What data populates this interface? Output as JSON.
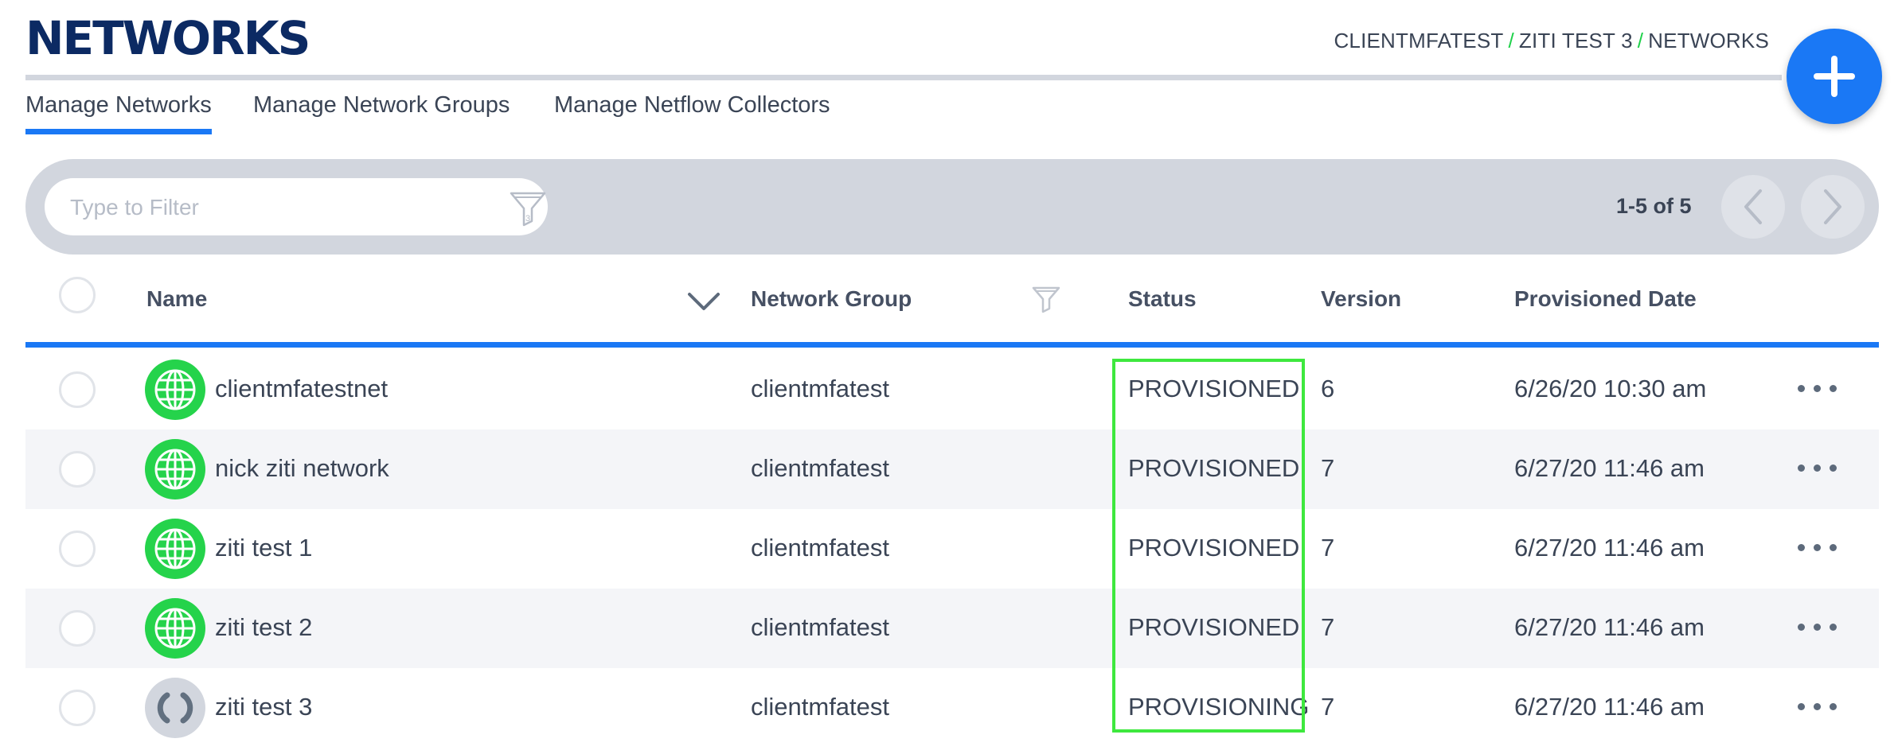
{
  "header": {
    "title": "NETWORKS",
    "breadcrumb": [
      "CLIENTMFATEST",
      "ZITI TEST 3",
      "NETWORKS"
    ],
    "breadcrumb_separator": "/"
  },
  "fab": {
    "icon": "plus-icon"
  },
  "tabs": [
    {
      "label": "Manage Networks",
      "active": true
    },
    {
      "label": "Manage Network Groups",
      "active": false
    },
    {
      "label": "Manage Netflow Collectors",
      "active": false
    }
  ],
  "filter": {
    "placeholder": "Type to Filter",
    "value": ""
  },
  "pagination": {
    "label": "1-5 of 5"
  },
  "columns": {
    "name": "Name",
    "network_group": "Network Group",
    "status": "Status",
    "version": "Version",
    "provisioned_date": "Provisioned Date"
  },
  "rows": [
    {
      "name": "clientmfatestnet",
      "network_group": "clientmfatest",
      "status": "PROVISIONED",
      "version": "6",
      "provisioned_date": "6/26/20 10:30 am",
      "icon": "globe-icon"
    },
    {
      "name": "nick ziti network",
      "network_group": "clientmfatest",
      "status": "PROVISIONED",
      "version": "7",
      "provisioned_date": "6/27/20 11:46 am",
      "icon": "globe-icon"
    },
    {
      "name": "ziti test 1",
      "network_group": "clientmfatest",
      "status": "PROVISIONED",
      "version": "7",
      "provisioned_date": "6/27/20 11:46 am",
      "icon": "globe-icon"
    },
    {
      "name": "ziti test 2",
      "network_group": "clientmfatest",
      "status": "PROVISIONED",
      "version": "7",
      "provisioned_date": "6/27/20 11:46 am",
      "icon": "globe-icon"
    },
    {
      "name": "ziti test 3",
      "network_group": "clientmfatest",
      "status": "PROVISIONING",
      "version": "7",
      "provisioned_date": "6/27/20 11:46 am",
      "icon": "spinner-icon"
    }
  ],
  "colors": {
    "accent": "#1a78f5",
    "title": "#0c2a63",
    "status_ok": "#25d34b",
    "highlight": "#3ee83e"
  }
}
